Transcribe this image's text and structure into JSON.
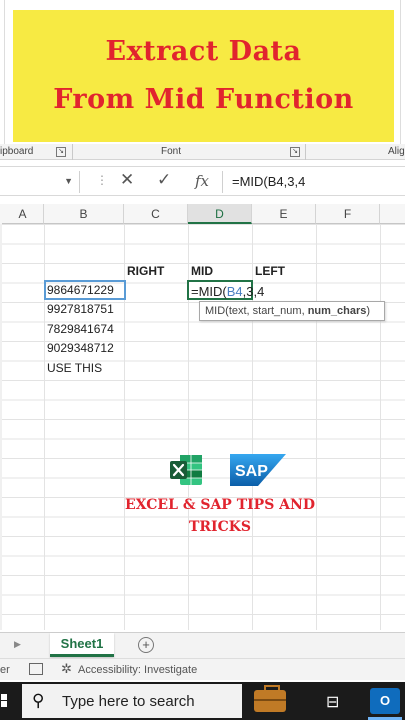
{
  "banner": {
    "line1": "Extract Data",
    "line2": "From Mid Function"
  },
  "ribbon": {
    "clipboard": "ipboard",
    "font": "Font",
    "alignment": "Alig"
  },
  "formula_bar": {
    "fx_symbol": "fx",
    "formula": "=MID(B4,3,4"
  },
  "columns": [
    "A",
    "B",
    "C",
    "D",
    "E",
    "F"
  ],
  "active_column": "D",
  "cells": {
    "c_header": "RIGHT",
    "d_header": "MID",
    "e_header": "LEFT",
    "b4": "9864671229",
    "b5": "9927818751",
    "b6": "7829841674",
    "b7": "9029348712",
    "b8": "USE THIS"
  },
  "editing": {
    "prefix": "=MID(",
    "ref": "B4",
    "suffix": ",3,4"
  },
  "tooltip": {
    "signature": "MID(text, start_num, ",
    "current_arg": "num_chars",
    "close": ")"
  },
  "promo": {
    "line1": "EXCEL & SAP TIPS AND",
    "line2": "TRICKS",
    "sap_logo_text": "SAP"
  },
  "sheet_tabs": {
    "active": "Sheet1"
  },
  "status_bar": {
    "left_fragment": "er",
    "accessibility": "Accessibility: Investigate"
  },
  "taskbar": {
    "search_placeholder": "Type here to search",
    "outlook_label": "O"
  },
  "colors": {
    "excel_green": "#217346",
    "banner_yellow": "#f7ea43",
    "banner_red": "#e1242e"
  }
}
